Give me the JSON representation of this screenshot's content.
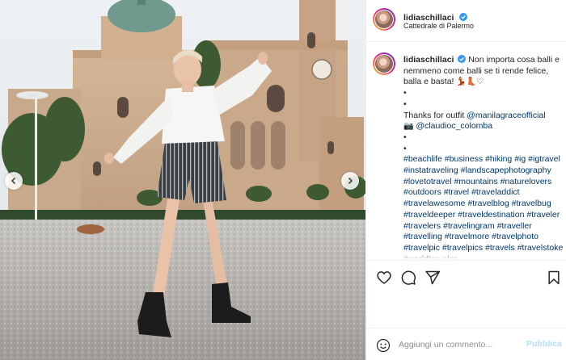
{
  "post": {
    "username": "lidiaschillaci",
    "location": "Cattedrale di Palermo",
    "caption": {
      "text": "Non importa cosa balli e nemmeno come balli se ti rende felice, balla e basta!",
      "dots": [
        "•",
        "•"
      ],
      "thanks_prefix": "Thanks for outfit",
      "thanks_mention": "@manilagraceofficial",
      "camera_mention": "@claudioc_colomba",
      "dots2": [
        "•",
        "•"
      ],
      "hashtags": [
        "#beachlife",
        "#business",
        "#hiking",
        "#ig",
        "#igtravel",
        "#instatraveling",
        "#landscapephotography",
        "#lovetotravel",
        "#mountains",
        "#naturelovers",
        "#outdoors",
        "#travel",
        "#traveladdict",
        "#travelawesome",
        "#travelblog",
        "#travelbug",
        "#traveldeeper",
        "#traveldestination",
        "#traveler",
        "#travelers",
        "#travelingram",
        "#traveller",
        "#travelling",
        "#travelmore",
        "#travelphoto",
        "#travelpic",
        "#travelpics",
        "#travels",
        "#travelstoke",
        "#worldtraveler"
      ]
    },
    "comment_box": {
      "placeholder": "Aggiungi un commento...",
      "publish_label": "Pubblica"
    }
  },
  "colors": {
    "link": "#00376b",
    "publish_disabled": "#b2dffc",
    "border": "#efefef",
    "verified": "#3897f0"
  },
  "icons": {
    "like": "heart-icon",
    "comment": "comment-icon",
    "share": "paper-plane-icon",
    "save": "bookmark-icon",
    "emoji": "smiley-icon",
    "prev": "chevron-left-icon",
    "next": "chevron-right-icon"
  }
}
